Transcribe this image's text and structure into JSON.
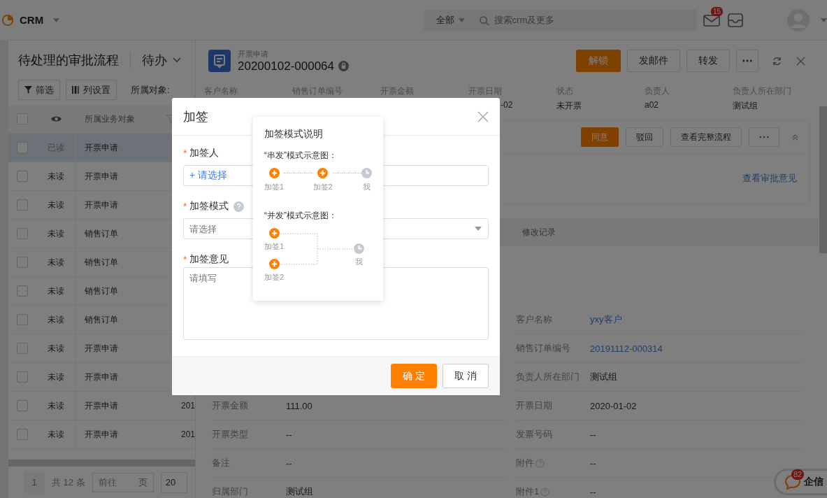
{
  "top_bar": {
    "app_name": "CRM",
    "scope": "全部",
    "search_placeholder": "搜索crm及更多",
    "mail_badge": "15"
  },
  "list_panel": {
    "title": "待处理的审批流程",
    "view": "待办",
    "toolbar": [
      {
        "kind": "filter",
        "label": "筛选"
      },
      {
        "kind": "columns",
        "label": "列设置"
      }
    ],
    "object_label": "所属对象:",
    "column_header": "所属业务对象",
    "header_checked": false,
    "rows": [
      {
        "status": "已读",
        "read": true,
        "selected": true,
        "checked": false,
        "object": "开票申请"
      },
      {
        "status": "未读",
        "read": false,
        "selected": false,
        "checked": false,
        "object": "开票申请"
      },
      {
        "status": "未读",
        "read": false,
        "selected": false,
        "checked": false,
        "object": "开票申请"
      },
      {
        "status": "未读",
        "read": false,
        "selected": false,
        "checked": false,
        "object": "销售订单"
      },
      {
        "status": "未读",
        "read": false,
        "selected": false,
        "checked": false,
        "object": "销售订单"
      },
      {
        "status": "未读",
        "read": false,
        "selected": false,
        "checked": false,
        "object": "销售订单"
      },
      {
        "status": "未读",
        "read": false,
        "selected": false,
        "checked": false,
        "object": "销售订单"
      },
      {
        "status": "未读",
        "read": false,
        "selected": false,
        "checked": false,
        "object": "开票申请"
      },
      {
        "status": "未读",
        "read": false,
        "selected": false,
        "checked": false,
        "object": "开票申请"
      },
      {
        "status": "未读",
        "read": false,
        "selected": false,
        "checked": false,
        "object": "开票申请",
        "column_3": "201"
      },
      {
        "status": "未读",
        "read": false,
        "selected": false,
        "checked": false,
        "object": "开票申请",
        "column_3": "201"
      }
    ],
    "pagination": {
      "page": "1",
      "total": "共 12 条",
      "goto": "前往",
      "unit": "页",
      "page_size": "20"
    }
  },
  "detail": {
    "type_label": "开票申请",
    "number": "20200102-000064",
    "actions": [
      {
        "label": "解锁",
        "primary": true
      },
      {
        "label": "发邮件",
        "primary": false
      },
      {
        "label": "转发",
        "primary": false
      }
    ],
    "summary": [
      {
        "label": "客户名称"
      },
      {
        "label": "销售订单编号"
      },
      {
        "label": "开票金额"
      },
      {
        "label": "开票日期",
        "value": "-02"
      },
      {
        "label": "状态",
        "value": "未开票"
      },
      {
        "label": "负责人",
        "value": "a02"
      },
      {
        "label": "负责人所在部门",
        "value": "测试组"
      }
    ],
    "approval": {
      "actions": [
        {
          "label": "同意",
          "primary": true
        },
        {
          "label": "驳回",
          "primary": false
        },
        {
          "label": "查看完整流程",
          "primary": false
        }
      ],
      "link": "查看审批意见"
    },
    "tabs": [
      {
        "label": "修改记录",
        "selected": false
      }
    ],
    "fields_left": [
      {
        "label": "开票金额",
        "value": "111.00",
        "link": false,
        "help": false
      },
      {
        "label": "开票类型",
        "value": "--",
        "link": false,
        "help": false
      },
      {
        "label": "备注",
        "value": "--",
        "link": false,
        "help": false
      },
      {
        "label": "归属部门",
        "value": "测试组",
        "link": false,
        "help": false
      }
    ],
    "fields_right": [
      {
        "label": "客户名称",
        "value": "yxy客户",
        "link": true,
        "help": false
      },
      {
        "label": "销售订单编号",
        "value": "20191112-000314",
        "link": true,
        "help": false
      },
      {
        "label": "负责人所在部门",
        "value": "测试组",
        "link": false,
        "help": false
      },
      {
        "label": "开票日期",
        "value": "2020-01-02",
        "link": false,
        "help": false
      },
      {
        "label": "发票号码",
        "value": "--",
        "link": false,
        "help": false
      },
      {
        "label": "附件",
        "value": "--",
        "link": false,
        "help": true
      },
      {
        "label": "附件1",
        "value": "--",
        "link": false,
        "help": true
      }
    ]
  },
  "chat": {
    "badge": "82",
    "label": "企信"
  },
  "dialog": {
    "title": "加签",
    "fields": [
      {
        "kind": "picker",
        "label": "加签人",
        "required_mark": "*",
        "help": false,
        "action": "+ 请选择"
      },
      {
        "kind": "select",
        "label": "加签模式",
        "required_mark": "*",
        "help": true,
        "placeholder": "请选择"
      },
      {
        "kind": "textarea",
        "label": "加签意见",
        "required_mark": "*",
        "help": false,
        "placeholder": "请填写"
      }
    ],
    "buttons": [
      {
        "label": "确 定",
        "primary": true
      },
      {
        "label": "取 消",
        "primary": false
      }
    ]
  },
  "popover": {
    "title": "加签模式说明",
    "serial": {
      "caption": "“串发”模式示意图：",
      "nodes": [
        {
          "kind": "add",
          "label": "加签1"
        },
        {
          "kind": "add",
          "label": "加签2"
        },
        {
          "kind": "self",
          "label": "我"
        }
      ]
    },
    "parallel": {
      "caption": "“并发”模式示意图：",
      "nodes": [
        {
          "kind": "add",
          "label": "加签1"
        },
        {
          "kind": "add",
          "label": "加签2"
        },
        {
          "kind": "self",
          "label": "我"
        }
      ]
    }
  }
}
